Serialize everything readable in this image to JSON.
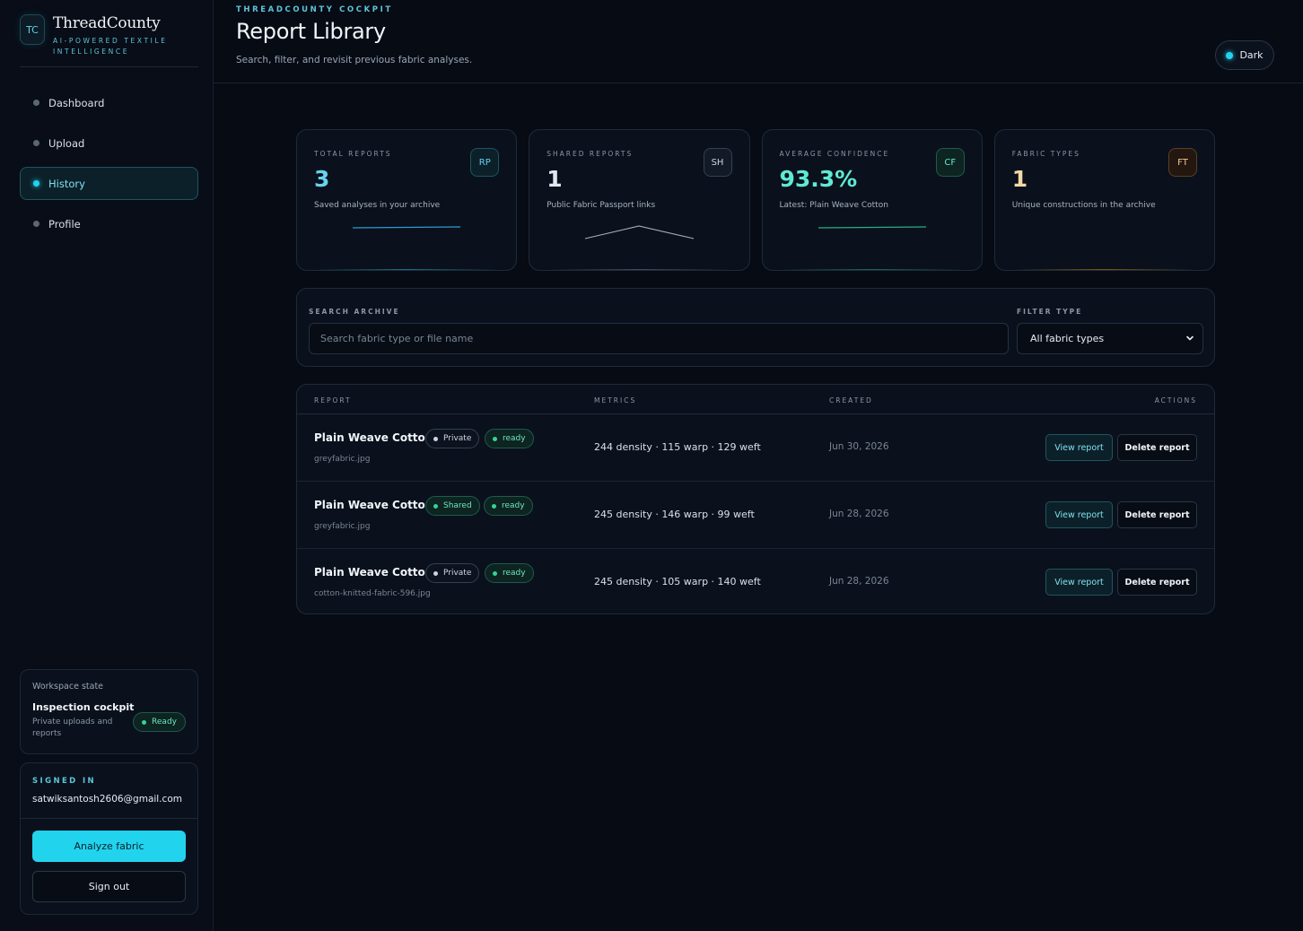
{
  "brand": {
    "badge": "TC",
    "name": "ThreadCounty",
    "tagline": "AI-POWERED TEXTILE INTELLIGENCE"
  },
  "nav": [
    {
      "label": "Dashboard",
      "active": false
    },
    {
      "label": "Upload",
      "active": false
    },
    {
      "label": "History",
      "active": true
    },
    {
      "label": "Profile",
      "active": false
    }
  ],
  "workspace": {
    "label": "Workspace state",
    "title": "Inspection cockpit",
    "subtitle": "Private uploads and reports",
    "status": "Ready"
  },
  "account": {
    "label": "SIGNED IN",
    "email": "satwiksantosh2606@gmail.com",
    "analyze_label": "Analyze fabric",
    "signout_label": "Sign out"
  },
  "header": {
    "eyebrow": "THREADCOUNTY COCKPIT",
    "title": "Report Library",
    "subtitle": "Search, filter, and revisit previous fabric analyses.",
    "theme_label": "Dark"
  },
  "stats": [
    {
      "label": "TOTAL REPORTS",
      "badge": "RP",
      "value": "3",
      "desc": "Saved analyses in your archive",
      "color": "#67d2f0"
    },
    {
      "label": "SHARED REPORTS",
      "badge": "SH",
      "value": "1",
      "desc": "Public Fabric Passport links",
      "color": "#e2e8f0"
    },
    {
      "label": "AVERAGE CONFIDENCE",
      "badge": "CF",
      "value": "93.3%",
      "desc": "Latest: Plain Weave Cotton",
      "color": "#5eead4"
    },
    {
      "label": "FABRIC TYPES",
      "badge": "FT",
      "value": "1",
      "desc": "Unique constructions in the archive",
      "color": "#f3d9a4"
    }
  ],
  "filters": {
    "search_label": "SEARCH ARCHIVE",
    "search_placeholder": "Search fabric type or file name",
    "type_label": "FILTER TYPE",
    "type_value": "All fabric types"
  },
  "table": {
    "headers": {
      "report": "REPORT",
      "metrics": "METRICS",
      "created": "CREATED",
      "actions": "ACTIONS"
    },
    "view_label": "View report",
    "delete_label": "Delete report",
    "rows": [
      {
        "name": "Plain Weave Cotton",
        "visibility": "Private",
        "status": "ready",
        "file": "greyfabric.jpg",
        "metrics": "244 density · 115 warp · 129 weft",
        "created": "Jun 30, 2026"
      },
      {
        "name": "Plain Weave Cotton",
        "visibility": "Shared",
        "status": "ready",
        "file": "greyfabric.jpg",
        "metrics": "245 density · 146 warp · 99 weft",
        "created": "Jun 28, 2026"
      },
      {
        "name": "Plain Weave Cotton",
        "visibility": "Private",
        "status": "ready",
        "file": "cotton-knitted-fabric-596.jpg",
        "metrics": "245 density · 105 warp · 140 weft",
        "created": "Jun 28, 2026"
      }
    ]
  }
}
